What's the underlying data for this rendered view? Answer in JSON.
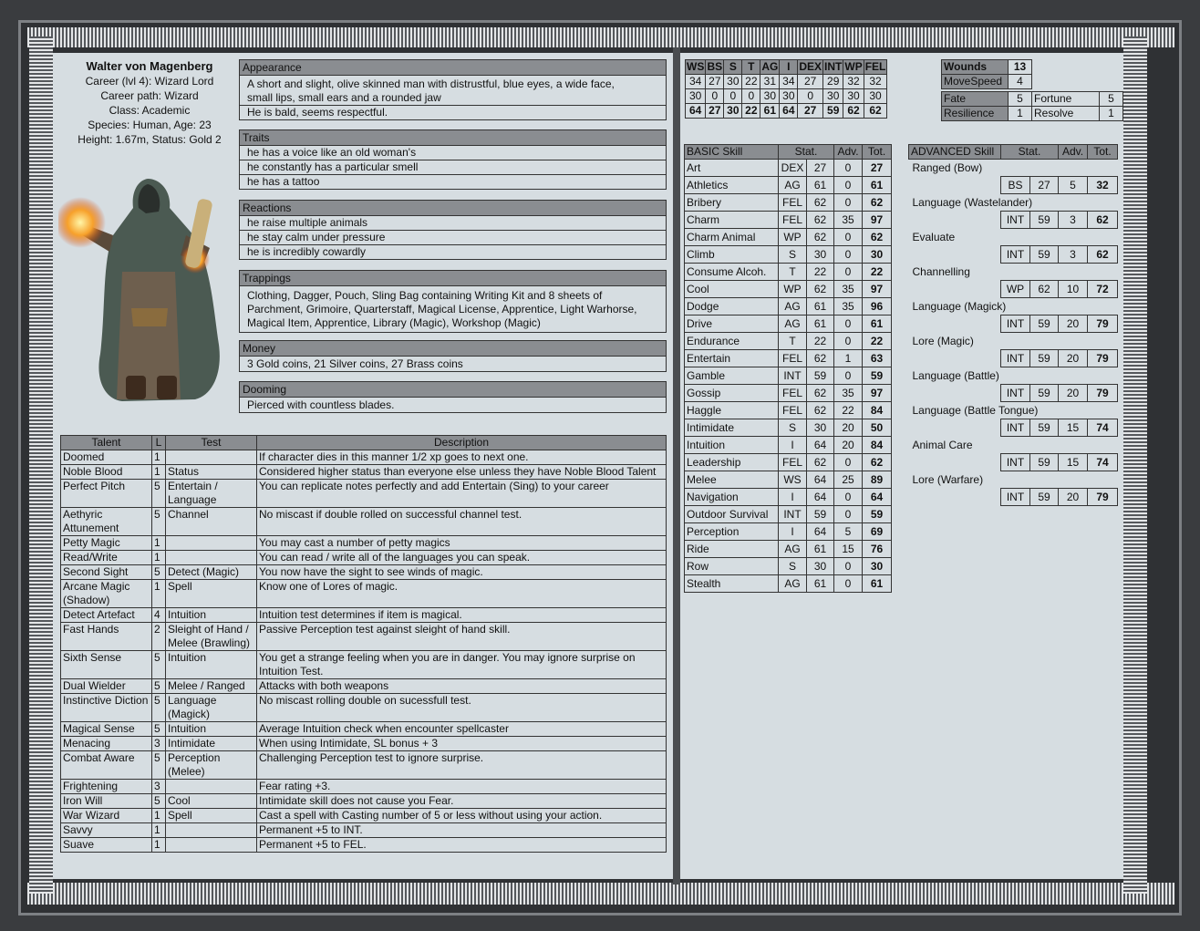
{
  "character": {
    "name": "Walter von Magenberg",
    "career": "Career (lvl 4): Wizard Lord",
    "career_path": "Career path: Wizard",
    "class": "Class: Academic",
    "species": "Species: Human, Age: 23",
    "height": "Height: 1.67m, Status: Gold 2"
  },
  "appearance": {
    "title": "Appearance",
    "lines": [
      "A short and slight, olive skinned man with distrustful, blue eyes, a wide face, small lips, small ears and a rounded jaw",
      "He is bald, seems respectful."
    ]
  },
  "traits": {
    "title": "Traits",
    "lines": [
      "he has a voice like an old woman's",
      "he constantly has a particular smell",
      "he has a tattoo"
    ]
  },
  "reactions": {
    "title": "Reactions",
    "lines": [
      "he raise multiple animals",
      "he stay calm under pressure",
      "he is incredibly cowardly"
    ]
  },
  "trappings": {
    "title": "Trappings",
    "text": "Clothing, Dagger, Pouch, Sling Bag containing Writing Kit and 8 sheets of Parchment, Grimoire, Quarterstaff, Magical License, Apprentice, Light Warhorse, Magical Item, Apprentice, Library (Magic), Workshop (Magic)"
  },
  "money": {
    "title": "Money",
    "text": "3 Gold coins, 21 Silver coins, 27 Brass coins"
  },
  "dooming": {
    "title": "Dooming",
    "text": "Pierced with countless blades."
  },
  "talents": {
    "headers": [
      "Talent",
      "L",
      "Test",
      "Description"
    ],
    "rows": [
      [
        "Doomed",
        "1",
        "",
        "If character dies in this manner 1/2 xp goes to next one."
      ],
      [
        "Noble Blood",
        "1",
        "Status",
        "Considered higher status than everyone else unless they have Noble Blood Talent"
      ],
      [
        "Perfect Pitch",
        "5",
        "Entertain / Language",
        "You can replicate notes perfectly and add Entertain (Sing) to your career"
      ],
      [
        "Aethyric Attunement",
        "5",
        "Channel",
        "No miscast if double rolled on successful channel test."
      ],
      [
        "Petty Magic",
        "1",
        "",
        "You may cast a number of petty magics"
      ],
      [
        "Read/Write",
        "1",
        "",
        "You can read / write all of the languages you can speak."
      ],
      [
        "Second Sight",
        "5",
        "Detect (Magic)",
        "You now have the sight to see winds of magic."
      ],
      [
        "Arcane Magic (Shadow)",
        "1",
        "Spell",
        "Know one of Lores of magic."
      ],
      [
        "Detect Artefact",
        "4",
        "Intuition",
        "Intuition test determines if item is magical."
      ],
      [
        "Fast Hands",
        "2",
        "Sleight of Hand / Melee (Brawling)",
        "Passive Perception test against sleight of hand skill."
      ],
      [
        "Sixth Sense",
        "5",
        "Intuition",
        "You get a strange feeling when you are in danger. You may ignore surprise on Intuition Test."
      ],
      [
        "Dual Wielder",
        "5",
        "Melee / Ranged",
        "Attacks with both weapons"
      ],
      [
        "Instinctive Diction",
        "5",
        "Language (Magick)",
        "No miscast rolling double on sucessfull test."
      ],
      [
        "Magical Sense",
        "5",
        "Intuition",
        "Average Intuition check when encounter spellcaster"
      ],
      [
        "Menacing",
        "3",
        "Intimidate",
        "When using Intimidate, SL bonus + 3"
      ],
      [
        "Combat Aware",
        "5",
        "Perception (Melee)",
        "Challenging Perception test to ignore surprise."
      ],
      [
        "Frightening",
        "3",
        "",
        "Fear rating +3."
      ],
      [
        "Iron Will",
        "5",
        "Cool",
        "Intimidate skill does not cause you Fear."
      ],
      [
        "War Wizard",
        "1",
        "Spell",
        "Cast a spell with Casting number of 5 or less without using your action."
      ],
      [
        "Savvy",
        "1",
        "",
        "Permanent +5 to INT."
      ],
      [
        "Suave",
        "1",
        "",
        "Permanent +5 to FEL."
      ]
    ]
  },
  "characteristics": {
    "headers": [
      "WS",
      "BS",
      "S",
      "T",
      "AG",
      "I",
      "DEX",
      "INT",
      "WP",
      "FEL"
    ],
    "base": [
      "34",
      "27",
      "30",
      "22",
      "31",
      "34",
      "27",
      "29",
      "32",
      "32"
    ],
    "adv": [
      "30",
      "0",
      "0",
      "0",
      "30",
      "30",
      "0",
      "30",
      "30",
      "30"
    ],
    "total": [
      "64",
      "27",
      "30",
      "22",
      "61",
      "64",
      "27",
      "59",
      "62",
      "62"
    ]
  },
  "status": {
    "wounds_label": "Wounds",
    "wounds": "13",
    "move_label": "MoveSpeed",
    "move": "4",
    "fate_label": "Fate",
    "fate": "5",
    "fortune_label": "Fortune",
    "fortune": "5",
    "resilience_label": "Resilience",
    "resilience": "1",
    "resolve_label": "Resolve",
    "resolve": "1"
  },
  "basic_skills": {
    "headers": [
      "BASIC Skill",
      "Stat.",
      "Adv.",
      "Tot."
    ],
    "rows": [
      [
        "Art",
        "DEX",
        "27",
        "0",
        "27"
      ],
      [
        "Athletics",
        "AG",
        "61",
        "0",
        "61"
      ],
      [
        "Bribery",
        "FEL",
        "62",
        "0",
        "62"
      ],
      [
        "Charm",
        "FEL",
        "62",
        "35",
        "97"
      ],
      [
        "Charm Animal",
        "WP",
        "62",
        "0",
        "62"
      ],
      [
        "Climb",
        "S",
        "30",
        "0",
        "30"
      ],
      [
        "Consume Alcoh.",
        "T",
        "22",
        "0",
        "22"
      ],
      [
        "Cool",
        "WP",
        "62",
        "35",
        "97"
      ],
      [
        "Dodge",
        "AG",
        "61",
        "35",
        "96"
      ],
      [
        "Drive",
        "AG",
        "61",
        "0",
        "61"
      ],
      [
        "Endurance",
        "T",
        "22",
        "0",
        "22"
      ],
      [
        "Entertain",
        "FEL",
        "62",
        "1",
        "63"
      ],
      [
        "Gamble",
        "INT",
        "59",
        "0",
        "59"
      ],
      [
        "Gossip",
        "FEL",
        "62",
        "35",
        "97"
      ],
      [
        "Haggle",
        "FEL",
        "62",
        "22",
        "84"
      ],
      [
        "Intimidate",
        "S",
        "30",
        "20",
        "50"
      ],
      [
        "Intuition",
        "I",
        "64",
        "20",
        "84"
      ],
      [
        "Leadership",
        "FEL",
        "62",
        "0",
        "62"
      ],
      [
        "Melee",
        "WS",
        "64",
        "25",
        "89"
      ],
      [
        "Navigation",
        "I",
        "64",
        "0",
        "64"
      ],
      [
        "Outdoor Survival",
        "INT",
        "59",
        "0",
        "59"
      ],
      [
        "Perception",
        "I",
        "64",
        "5",
        "69"
      ],
      [
        "Ride",
        "AG",
        "61",
        "15",
        "76"
      ],
      [
        "Row",
        "S",
        "30",
        "0",
        "30"
      ],
      [
        "Stealth",
        "AG",
        "61",
        "0",
        "61"
      ]
    ]
  },
  "advanced_skills": {
    "headers": [
      "ADVANCED Skill",
      "Stat.",
      "Adv.",
      "Tot."
    ],
    "rows": [
      [
        "Ranged (Bow)",
        "BS",
        "27",
        "5",
        "32"
      ],
      [
        "Language (Wastelander)",
        "INT",
        "59",
        "3",
        "62"
      ],
      [
        "Evaluate",
        "INT",
        "59",
        "3",
        "62"
      ],
      [
        "Channelling",
        "WP",
        "62",
        "10",
        "72"
      ],
      [
        "Language (Magick)",
        "INT",
        "59",
        "20",
        "79"
      ],
      [
        "Lore (Magic)",
        "INT",
        "59",
        "20",
        "79"
      ],
      [
        "Language (Battle)",
        "INT",
        "59",
        "20",
        "79"
      ],
      [
        "Language (Battle Tongue)",
        "INT",
        "59",
        "15",
        "74"
      ],
      [
        "Animal Care",
        "INT",
        "59",
        "15",
        "74"
      ],
      [
        "Lore (Warfare)",
        "INT",
        "59",
        "20",
        "79"
      ]
    ]
  }
}
